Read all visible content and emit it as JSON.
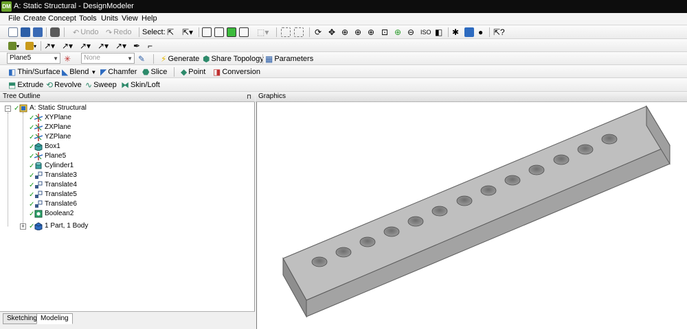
{
  "window": {
    "title": "A: Static Structural - DesignModeler",
    "app_badge": "DM"
  },
  "menu": [
    "File",
    "Create",
    "Concept",
    "Tools",
    "Units",
    "View",
    "Help"
  ],
  "toolbar1": {
    "undo_label": "Undo",
    "redo_label": "Redo",
    "select_label": "Select:"
  },
  "toolbar3": {
    "plane_value": "Plane5",
    "sketch_value": "None",
    "generate_label": "Generate",
    "share_topology_label": "Share Topology",
    "parameters_label": "Parameters"
  },
  "toolbar4": {
    "thin_surface_label": "Thin/Surface",
    "blend_label": "Blend",
    "chamfer_label": "Chamfer",
    "slice_label": "Slice",
    "point_label": "Point",
    "conversion_label": "Conversion"
  },
  "toolbar5": {
    "extrude_label": "Extrude",
    "revolve_label": "Revolve",
    "sweep_label": "Sweep",
    "skin_loft_label": "Skin/Loft"
  },
  "tree": {
    "header": "Tree Outline",
    "root": "A: Static Structural",
    "items": [
      {
        "label": "XYPlane",
        "icon": "plane-icon"
      },
      {
        "label": "ZXPlane",
        "icon": "plane-icon"
      },
      {
        "label": "YZPlane",
        "icon": "plane-icon"
      },
      {
        "label": "Box1",
        "icon": "box-icon"
      },
      {
        "label": "Plane5",
        "icon": "plane-icon"
      },
      {
        "label": "Cylinder1",
        "icon": "cylinder-icon"
      },
      {
        "label": "Translate3",
        "icon": "translate-icon"
      },
      {
        "label": "Translate4",
        "icon": "translate-icon"
      },
      {
        "label": "Translate5",
        "icon": "translate-icon"
      },
      {
        "label": "Translate6",
        "icon": "translate-icon"
      },
      {
        "label": "Boolean2",
        "icon": "boolean-icon"
      },
      {
        "label": "1 Part, 1 Body",
        "icon": "body-icon"
      }
    ]
  },
  "tabs": {
    "sketching": "Sketching",
    "modeling": "Modeling"
  },
  "graphics": {
    "header": "Graphics"
  },
  "colors": {
    "accent": "#1e6bb8",
    "check_green": "#1d9a1d",
    "body_face": "#bdbdbd"
  }
}
